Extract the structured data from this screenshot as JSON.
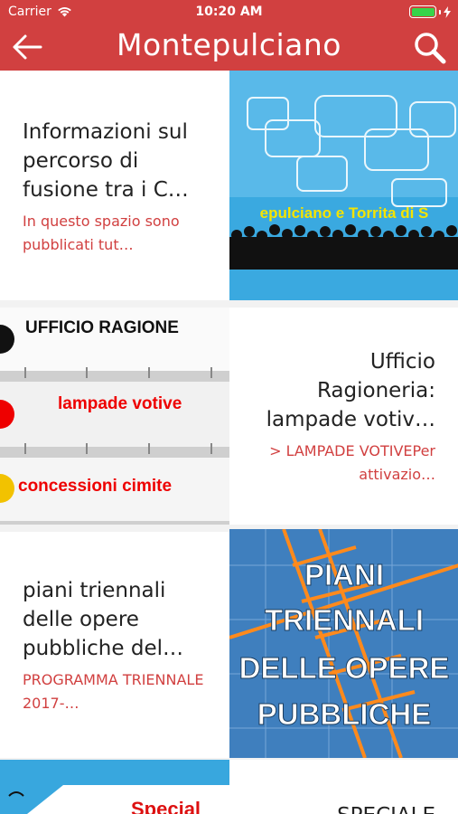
{
  "status_bar": {
    "carrier": "Carrier",
    "time": "10:20 AM"
  },
  "navbar": {
    "title": "Montepulciano"
  },
  "articles": [
    {
      "title": "Informazioni sul percorso di fusione tra i C…",
      "description": "In questo spazio sono pubblicati tut…",
      "image_caption": "epulciano e Torrita di S"
    },
    {
      "title": "Ufficio Ragioneria: lampade votiv…",
      "description": "> LAMPADE VOTIVEPer attivazio…",
      "image_lines": [
        "UFFICIO RAGIONE",
        "lampade votive",
        "concessioni cimite"
      ]
    },
    {
      "title": "piani triennali delle opere pubbliche del…",
      "description": "PROGRAMMA TRIENNALE 2017-…",
      "image_lines": [
        "PIANI",
        "TRIENNALI",
        "DELLE OPERE",
        "PUBBLICHE"
      ]
    },
    {
      "title": "SPECIALE",
      "image_caption": "Special"
    }
  ],
  "colors": {
    "brand": "#d14040",
    "text": "#222222"
  }
}
